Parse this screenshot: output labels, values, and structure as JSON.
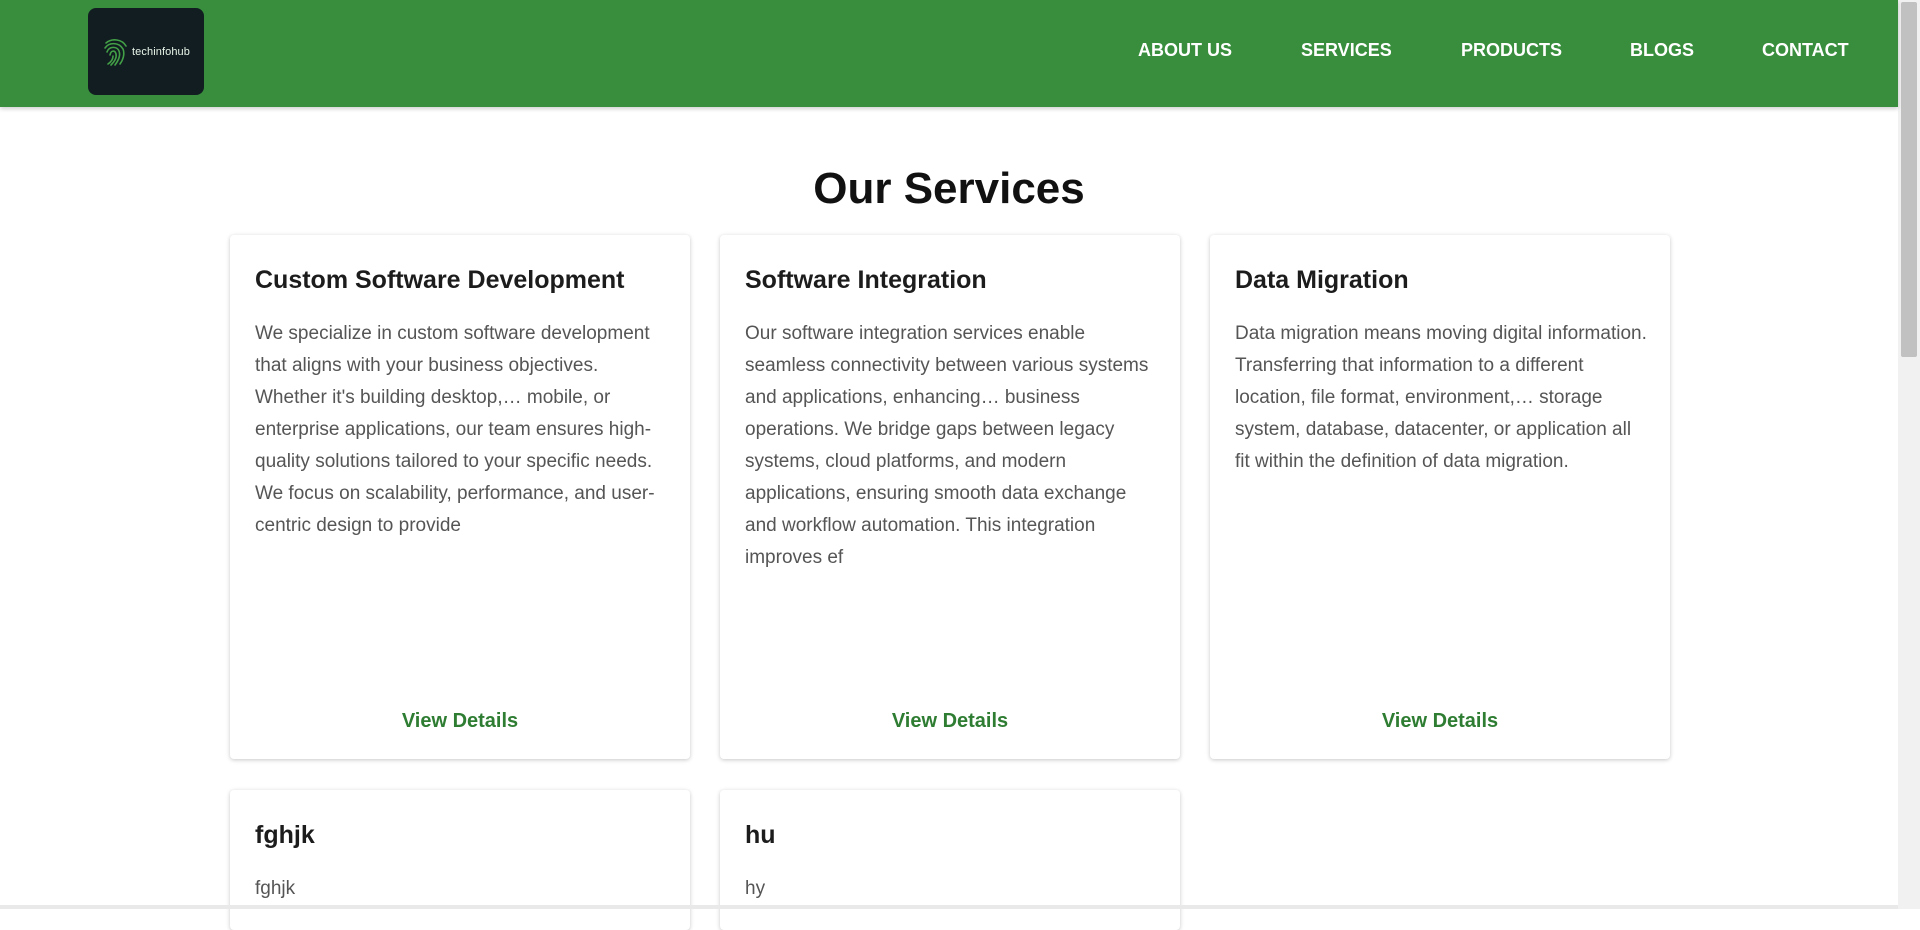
{
  "brand": {
    "logo_text": "techinfohub"
  },
  "nav": {
    "items": [
      {
        "label": "ABOUT US"
      },
      {
        "label": "SERVICES"
      },
      {
        "label": "PRODUCTS"
      },
      {
        "label": "BLOGS"
      },
      {
        "label": "CONTACT"
      }
    ]
  },
  "page": {
    "title": "Our Services"
  },
  "services": [
    {
      "title": "Custom Software Development",
      "description": "We specialize in custom software development that aligns with your business objectives. Whether it's building desktop,… mobile, or enterprise applications, our team ensures high-quality solutions tailored to your specific needs. We focus on scalability, performance, and user-centric design to provide",
      "action_label": "View Details"
    },
    {
      "title": "Software Integration",
      "description": "Our software integration services enable seamless connectivity between various systems and applications, enhancing… business operations. We bridge gaps between legacy systems, cloud platforms, and modern applications, ensuring smooth data exchange and workflow automation. This integration improves ef",
      "action_label": "View Details"
    },
    {
      "title": "Data Migration",
      "description": "Data migration means moving digital information. Transferring that information to a different location, file format, environment,… storage system, database, datacenter, or application all fit within the definition of data migration.",
      "action_label": "View Details"
    },
    {
      "title": "fghjk",
      "description": "fghjk",
      "action_label": ""
    },
    {
      "title": "hu",
      "description": "hy",
      "action_label": ""
    }
  ],
  "colors": {
    "header_bg": "#388e3c",
    "link_green": "#2e7d32",
    "logo_bg": "#111d21"
  }
}
